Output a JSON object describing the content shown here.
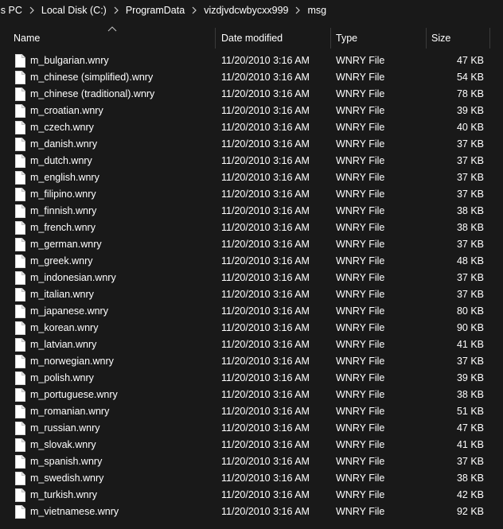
{
  "breadcrumb": [
    "is PC",
    "Local Disk (C:)",
    "ProgramData",
    "vizdjvdcwbycxx999",
    "msg"
  ],
  "columns": {
    "name": "Name",
    "date": "Date modified",
    "type": "Type",
    "size": "Size"
  },
  "icons": {
    "breadcrumb_separator": "chevron-right-icon",
    "sort": "sort-ascending-icon",
    "file": "file-icon"
  },
  "colors": {
    "background": "#191919",
    "text": "#ffffff",
    "divider": "#3b3b3b"
  },
  "files": [
    {
      "name": "m_bulgarian.wnry",
      "date": "11/20/2010 3:16 AM",
      "type": "WNRY File",
      "size": "47 KB"
    },
    {
      "name": "m_chinese (simplified).wnry",
      "date": "11/20/2010 3:16 AM",
      "type": "WNRY File",
      "size": "54 KB"
    },
    {
      "name": "m_chinese (traditional).wnry",
      "date": "11/20/2010 3:16 AM",
      "type": "WNRY File",
      "size": "78 KB"
    },
    {
      "name": "m_croatian.wnry",
      "date": "11/20/2010 3:16 AM",
      "type": "WNRY File",
      "size": "39 KB"
    },
    {
      "name": "m_czech.wnry",
      "date": "11/20/2010 3:16 AM",
      "type": "WNRY File",
      "size": "40 KB"
    },
    {
      "name": "m_danish.wnry",
      "date": "11/20/2010 3:16 AM",
      "type": "WNRY File",
      "size": "37 KB"
    },
    {
      "name": "m_dutch.wnry",
      "date": "11/20/2010 3:16 AM",
      "type": "WNRY File",
      "size": "37 KB"
    },
    {
      "name": "m_english.wnry",
      "date": "11/20/2010 3:16 AM",
      "type": "WNRY File",
      "size": "37 KB"
    },
    {
      "name": "m_filipino.wnry",
      "date": "11/20/2010 3:16 AM",
      "type": "WNRY File",
      "size": "37 KB"
    },
    {
      "name": "m_finnish.wnry",
      "date": "11/20/2010 3:16 AM",
      "type": "WNRY File",
      "size": "38 KB"
    },
    {
      "name": "m_french.wnry",
      "date": "11/20/2010 3:16 AM",
      "type": "WNRY File",
      "size": "38 KB"
    },
    {
      "name": "m_german.wnry",
      "date": "11/20/2010 3:16 AM",
      "type": "WNRY File",
      "size": "37 KB"
    },
    {
      "name": "m_greek.wnry",
      "date": "11/20/2010 3:16 AM",
      "type": "WNRY File",
      "size": "48 KB"
    },
    {
      "name": "m_indonesian.wnry",
      "date": "11/20/2010 3:16 AM",
      "type": "WNRY File",
      "size": "37 KB"
    },
    {
      "name": "m_italian.wnry",
      "date": "11/20/2010 3:16 AM",
      "type": "WNRY File",
      "size": "37 KB"
    },
    {
      "name": "m_japanese.wnry",
      "date": "11/20/2010 3:16 AM",
      "type": "WNRY File",
      "size": "80 KB"
    },
    {
      "name": "m_korean.wnry",
      "date": "11/20/2010 3:16 AM",
      "type": "WNRY File",
      "size": "90 KB"
    },
    {
      "name": "m_latvian.wnry",
      "date": "11/20/2010 3:16 AM",
      "type": "WNRY File",
      "size": "41 KB"
    },
    {
      "name": "m_norwegian.wnry",
      "date": "11/20/2010 3:16 AM",
      "type": "WNRY File",
      "size": "37 KB"
    },
    {
      "name": "m_polish.wnry",
      "date": "11/20/2010 3:16 AM",
      "type": "WNRY File",
      "size": "39 KB"
    },
    {
      "name": "m_portuguese.wnry",
      "date": "11/20/2010 3:16 AM",
      "type": "WNRY File",
      "size": "38 KB"
    },
    {
      "name": "m_romanian.wnry",
      "date": "11/20/2010 3:16 AM",
      "type": "WNRY File",
      "size": "51 KB"
    },
    {
      "name": "m_russian.wnry",
      "date": "11/20/2010 3:16 AM",
      "type": "WNRY File",
      "size": "47 KB"
    },
    {
      "name": "m_slovak.wnry",
      "date": "11/20/2010 3:16 AM",
      "type": "WNRY File",
      "size": "41 KB"
    },
    {
      "name": "m_spanish.wnry",
      "date": "11/20/2010 3:16 AM",
      "type": "WNRY File",
      "size": "37 KB"
    },
    {
      "name": "m_swedish.wnry",
      "date": "11/20/2010 3:16 AM",
      "type": "WNRY File",
      "size": "38 KB"
    },
    {
      "name": "m_turkish.wnry",
      "date": "11/20/2010 3:16 AM",
      "type": "WNRY File",
      "size": "42 KB"
    },
    {
      "name": "m_vietnamese.wnry",
      "date": "11/20/2010 3:16 AM",
      "type": "WNRY File",
      "size": "92 KB"
    }
  ]
}
